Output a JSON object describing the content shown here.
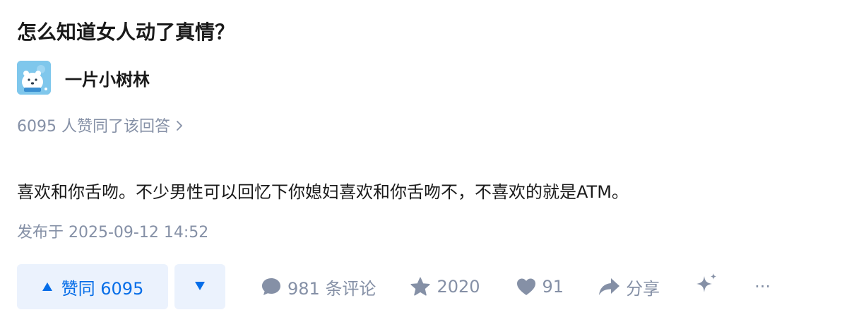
{
  "question": {
    "title": "怎么知道女人动了真情？"
  },
  "author": {
    "name": "一片小树林",
    "avatar_icon": "polar-bear-avatar"
  },
  "voters": {
    "text": "6095 人赞同了该回答",
    "chevron": "›"
  },
  "answer": {
    "content": "喜欢和你舌吻。不少男性可以回忆下你媳妇喜欢和你舌吻不，不喜欢的就是ATM。",
    "published": "发布于 2025-09-12 14:52"
  },
  "actions": {
    "upvote_label": "赞同 6095",
    "comment_label": "981 条评论",
    "favorite_count": "2020",
    "like_count": "91",
    "share_label": "分享",
    "more_label": "···"
  },
  "colors": {
    "accent": "#056de8",
    "accent_bg": "#ebf2fd",
    "muted": "#8590a6",
    "text": "#1a1a1a"
  }
}
